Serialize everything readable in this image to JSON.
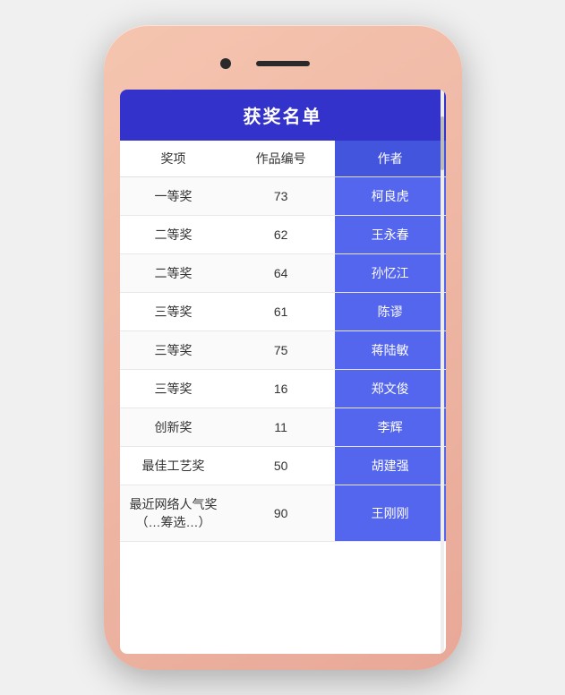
{
  "phone": {
    "title": "获奖名单"
  },
  "table": {
    "headers": {
      "award": "奖项",
      "id": "作品编号",
      "author": "作者"
    },
    "rows": [
      {
        "award": "一等奖",
        "id": "73",
        "author": "柯良虎"
      },
      {
        "award": "二等奖",
        "id": "62",
        "author": "王永春"
      },
      {
        "award": "二等奖",
        "id": "64",
        "author": "孙忆江"
      },
      {
        "award": "三等奖",
        "id": "61",
        "author": "陈谬"
      },
      {
        "award": "三等奖",
        "id": "75",
        "author": "蒋陆敏"
      },
      {
        "award": "三等奖",
        "id": "16",
        "author": "郑文俊"
      },
      {
        "award": "创新奖",
        "id": "11",
        "author": "李辉"
      },
      {
        "award": "最佳工艺奖",
        "id": "50",
        "author": "胡建强"
      },
      {
        "award": "最近网络人气奖（…筹选…）",
        "id": "90",
        "author": "王刚刚"
      }
    ]
  }
}
